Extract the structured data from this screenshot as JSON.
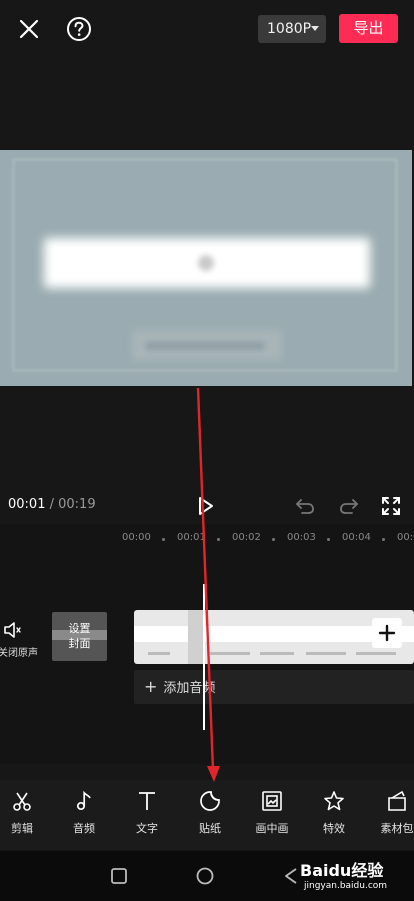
{
  "topbar": {
    "resolution": "1080P",
    "export_label": "导出"
  },
  "player": {
    "current_time": "00:01",
    "separator": " / ",
    "total_time": "00:19"
  },
  "timeline": {
    "ruler": [
      "00:00",
      "00:01",
      "00:02",
      "00:03",
      "00:04",
      "00:0"
    ],
    "mute_label": "关闭原声",
    "cover_line1": "设置",
    "cover_line2": "封面",
    "add_audio_label": "添加音频"
  },
  "toolbar": {
    "items": [
      {
        "label": "剪辑",
        "icon": "scissors-icon"
      },
      {
        "label": "音频",
        "icon": "music-note-icon"
      },
      {
        "label": "文字",
        "icon": "text-icon"
      },
      {
        "label": "贴纸",
        "icon": "sticker-icon"
      },
      {
        "label": "画中画",
        "icon": "picture-in-picture-icon"
      },
      {
        "label": "特效",
        "icon": "star-effect-icon"
      },
      {
        "label": "素材包",
        "icon": "material-pack-icon"
      }
    ]
  },
  "watermark": {
    "brand": "Baidu经验",
    "url": "jingyan.baidu.com"
  },
  "colors": {
    "accent": "#fe2c55",
    "annotation": "#e0262c"
  }
}
